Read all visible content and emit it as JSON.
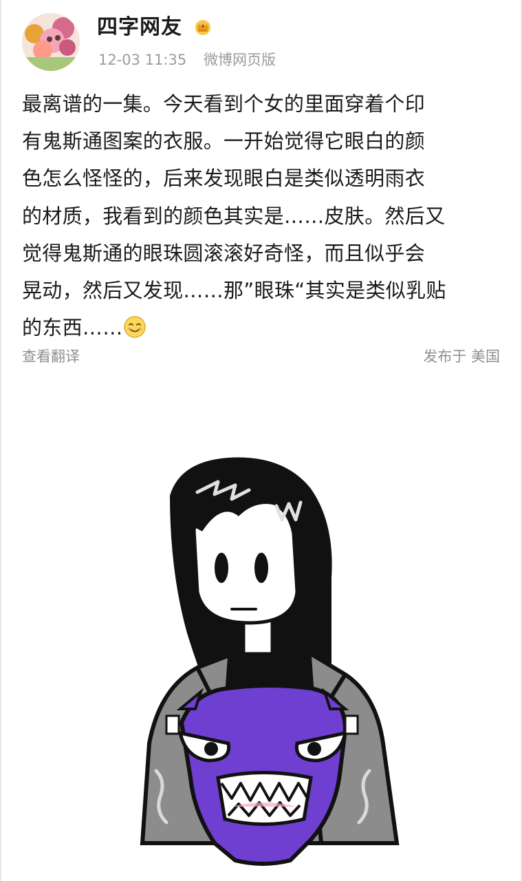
{
  "post": {
    "username": "四字网友",
    "time": "12-03 11:35",
    "source": "微博网页版",
    "lines": [
      "最离谱的一集。今天看到个女的里面穿着个印",
      "有鬼斯通图案的衣服。一开始觉得它眼白的颜",
      "色怎么怪怪的，后来发现眼白是类似透明雨衣",
      "的材质，我看到的颜色其实是……皮肤。然后又",
      "觉得鬼斯通的眼珠圆滚滚好奇怪，而且似乎会",
      "晃动，然后又发现……那”眼珠“其实是类似乳贴",
      "的东西……"
    ],
    "translate_label": "查看翻译",
    "location_label": "发布于 美国"
  },
  "icons": {
    "badge": "crown-icon",
    "emoji": "smile-emoji-icon"
  },
  "colors": {
    "text": "#1a1a1a",
    "meta": "#9b9b9b",
    "ghost_purple": "#6f3fd1",
    "jacket_gray": "#8c8c8c",
    "hair_black": "#111111"
  }
}
